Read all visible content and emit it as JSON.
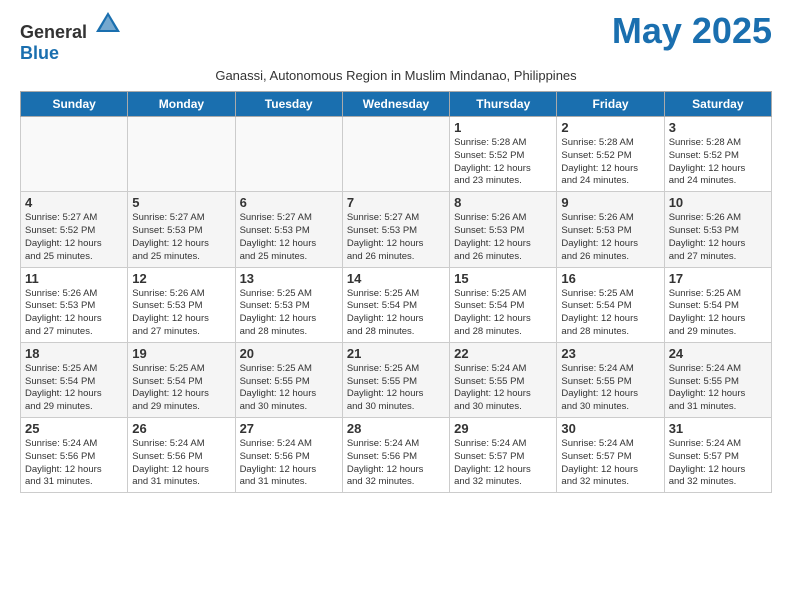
{
  "header": {
    "logo_general": "General",
    "logo_blue": "Blue",
    "month_title": "May 2025",
    "subtitle": "Ganassi, Autonomous Region in Muslim Mindanao, Philippines"
  },
  "days_of_week": [
    "Sunday",
    "Monday",
    "Tuesday",
    "Wednesday",
    "Thursday",
    "Friday",
    "Saturday"
  ],
  "weeks": [
    [
      {
        "day": "",
        "info": ""
      },
      {
        "day": "",
        "info": ""
      },
      {
        "day": "",
        "info": ""
      },
      {
        "day": "",
        "info": ""
      },
      {
        "day": "1",
        "info": "Sunrise: 5:28 AM\nSunset: 5:52 PM\nDaylight: 12 hours\nand 23 minutes."
      },
      {
        "day": "2",
        "info": "Sunrise: 5:28 AM\nSunset: 5:52 PM\nDaylight: 12 hours\nand 24 minutes."
      },
      {
        "day": "3",
        "info": "Sunrise: 5:28 AM\nSunset: 5:52 PM\nDaylight: 12 hours\nand 24 minutes."
      }
    ],
    [
      {
        "day": "4",
        "info": "Sunrise: 5:27 AM\nSunset: 5:52 PM\nDaylight: 12 hours\nand 25 minutes."
      },
      {
        "day": "5",
        "info": "Sunrise: 5:27 AM\nSunset: 5:53 PM\nDaylight: 12 hours\nand 25 minutes."
      },
      {
        "day": "6",
        "info": "Sunrise: 5:27 AM\nSunset: 5:53 PM\nDaylight: 12 hours\nand 25 minutes."
      },
      {
        "day": "7",
        "info": "Sunrise: 5:27 AM\nSunset: 5:53 PM\nDaylight: 12 hours\nand 26 minutes."
      },
      {
        "day": "8",
        "info": "Sunrise: 5:26 AM\nSunset: 5:53 PM\nDaylight: 12 hours\nand 26 minutes."
      },
      {
        "day": "9",
        "info": "Sunrise: 5:26 AM\nSunset: 5:53 PM\nDaylight: 12 hours\nand 26 minutes."
      },
      {
        "day": "10",
        "info": "Sunrise: 5:26 AM\nSunset: 5:53 PM\nDaylight: 12 hours\nand 27 minutes."
      }
    ],
    [
      {
        "day": "11",
        "info": "Sunrise: 5:26 AM\nSunset: 5:53 PM\nDaylight: 12 hours\nand 27 minutes."
      },
      {
        "day": "12",
        "info": "Sunrise: 5:26 AM\nSunset: 5:53 PM\nDaylight: 12 hours\nand 27 minutes."
      },
      {
        "day": "13",
        "info": "Sunrise: 5:25 AM\nSunset: 5:53 PM\nDaylight: 12 hours\nand 28 minutes."
      },
      {
        "day": "14",
        "info": "Sunrise: 5:25 AM\nSunset: 5:54 PM\nDaylight: 12 hours\nand 28 minutes."
      },
      {
        "day": "15",
        "info": "Sunrise: 5:25 AM\nSunset: 5:54 PM\nDaylight: 12 hours\nand 28 minutes."
      },
      {
        "day": "16",
        "info": "Sunrise: 5:25 AM\nSunset: 5:54 PM\nDaylight: 12 hours\nand 28 minutes."
      },
      {
        "day": "17",
        "info": "Sunrise: 5:25 AM\nSunset: 5:54 PM\nDaylight: 12 hours\nand 29 minutes."
      }
    ],
    [
      {
        "day": "18",
        "info": "Sunrise: 5:25 AM\nSunset: 5:54 PM\nDaylight: 12 hours\nand 29 minutes."
      },
      {
        "day": "19",
        "info": "Sunrise: 5:25 AM\nSunset: 5:54 PM\nDaylight: 12 hours\nand 29 minutes."
      },
      {
        "day": "20",
        "info": "Sunrise: 5:25 AM\nSunset: 5:55 PM\nDaylight: 12 hours\nand 30 minutes."
      },
      {
        "day": "21",
        "info": "Sunrise: 5:25 AM\nSunset: 5:55 PM\nDaylight: 12 hours\nand 30 minutes."
      },
      {
        "day": "22",
        "info": "Sunrise: 5:24 AM\nSunset: 5:55 PM\nDaylight: 12 hours\nand 30 minutes."
      },
      {
        "day": "23",
        "info": "Sunrise: 5:24 AM\nSunset: 5:55 PM\nDaylight: 12 hours\nand 30 minutes."
      },
      {
        "day": "24",
        "info": "Sunrise: 5:24 AM\nSunset: 5:55 PM\nDaylight: 12 hours\nand 31 minutes."
      }
    ],
    [
      {
        "day": "25",
        "info": "Sunrise: 5:24 AM\nSunset: 5:56 PM\nDaylight: 12 hours\nand 31 minutes."
      },
      {
        "day": "26",
        "info": "Sunrise: 5:24 AM\nSunset: 5:56 PM\nDaylight: 12 hours\nand 31 minutes."
      },
      {
        "day": "27",
        "info": "Sunrise: 5:24 AM\nSunset: 5:56 PM\nDaylight: 12 hours\nand 31 minutes."
      },
      {
        "day": "28",
        "info": "Sunrise: 5:24 AM\nSunset: 5:56 PM\nDaylight: 12 hours\nand 32 minutes."
      },
      {
        "day": "29",
        "info": "Sunrise: 5:24 AM\nSunset: 5:57 PM\nDaylight: 12 hours\nand 32 minutes."
      },
      {
        "day": "30",
        "info": "Sunrise: 5:24 AM\nSunset: 5:57 PM\nDaylight: 12 hours\nand 32 minutes."
      },
      {
        "day": "31",
        "info": "Sunrise: 5:24 AM\nSunset: 5:57 PM\nDaylight: 12 hours\nand 32 minutes."
      }
    ]
  ]
}
